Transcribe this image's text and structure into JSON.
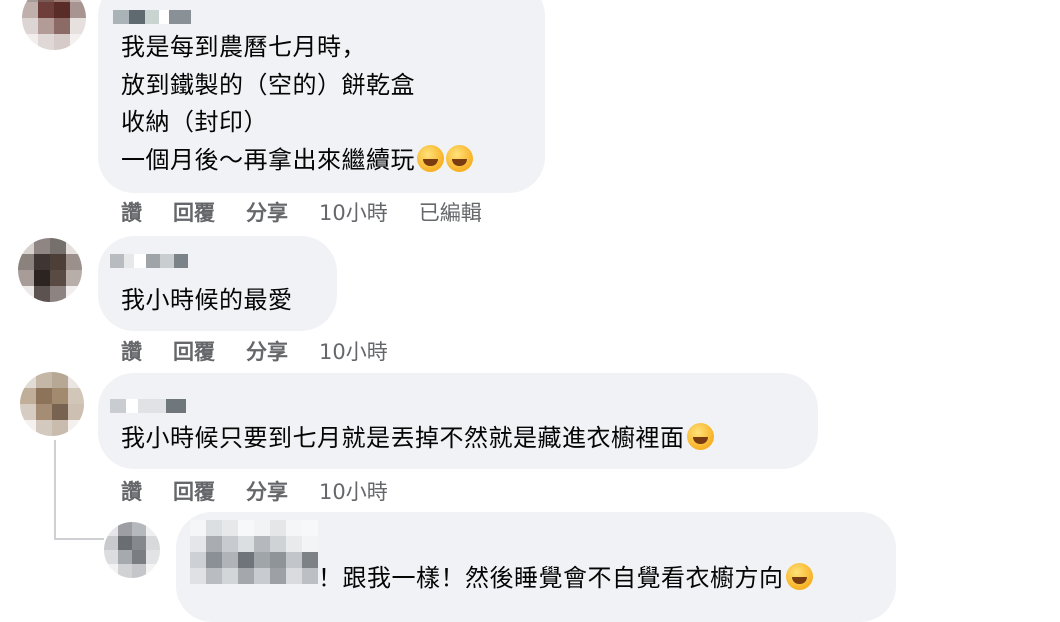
{
  "comments": [
    {
      "lines": [
        "我是每到農曆七月時，",
        "放到鐵製的（空的）餅乾盒",
        "收納（封印）",
        "一個月後～再拿出來繼續玩"
      ],
      "emoji": [
        "rolling-laughing-emoji",
        "rolling-laughing-emoji"
      ],
      "actions": {
        "like": "讚",
        "reply": "回覆",
        "share": "分享",
        "time": "10小時",
        "edited": "已編輯"
      }
    },
    {
      "lines": [
        "我小時候的最愛"
      ],
      "actions": {
        "like": "讚",
        "reply": "回覆",
        "share": "分享",
        "time": "10小時"
      }
    },
    {
      "lines": [
        "我小時候只要到七月就是丟掉不然就是藏進衣櫥裡面"
      ],
      "emoji": [
        "grinning-sweat-emoji"
      ],
      "actions": {
        "like": "讚",
        "reply": "回覆",
        "share": "分享",
        "time": "10小時"
      }
    },
    {
      "lines": [
        "！跟我一樣！然後睡覺會不自覺看衣櫥方向"
      ],
      "emoji": [
        "grinning-sweat-emoji"
      ]
    }
  ],
  "colors": {
    "bubble": "#f0f2f5",
    "action_text": "#65676b",
    "text": "#050505"
  }
}
